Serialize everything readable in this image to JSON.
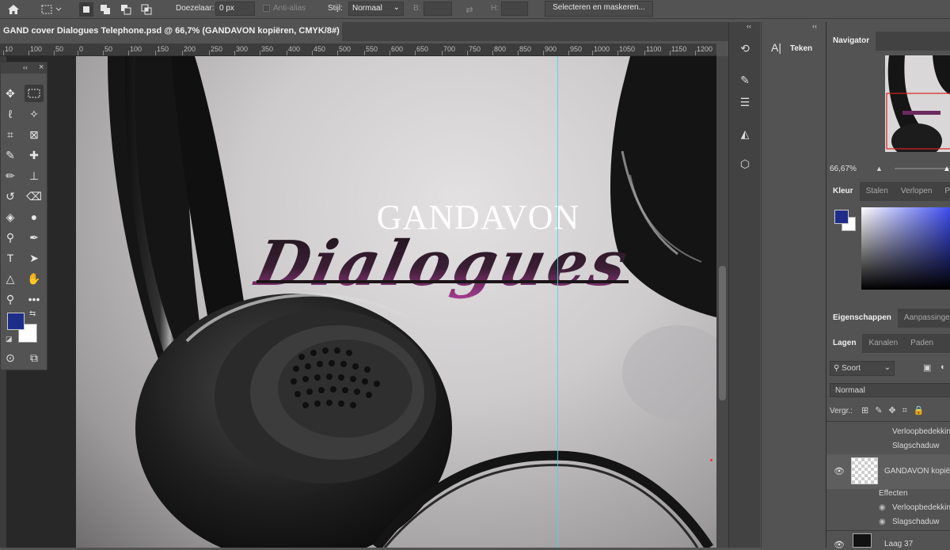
{
  "options_bar": {
    "home_icon": "home-icon",
    "marquee_icon": "rect-marquee-icon",
    "feather_label": "Doezelaar:",
    "feather_value": "0 px",
    "antialias_label": "Anti-alias",
    "style_label": "Stijl:",
    "style_value": "Normaal",
    "width_label": "B:",
    "height_label": "H:",
    "select_mask_label": "Selecteren en maskeren..."
  },
  "document": {
    "tab_title": "GAND cover Dialogues Telephone.psd @ 66,7% (GANDAVON kopiëren, CMYK/8#)",
    "close_glyph": "×"
  },
  "ruler": {
    "ticks": [
      "10",
      "100",
      "50",
      "0",
      "50",
      "100",
      "150",
      "200",
      "250",
      "300",
      "350",
      "400",
      "450",
      "500",
      "550",
      "600",
      "650",
      "700",
      "750",
      "800",
      "850",
      "900",
      "950",
      "1000",
      "1050",
      "1100",
      "1150",
      "1200"
    ]
  },
  "artwork": {
    "brand": "GANDAVON",
    "title": "Dialogues"
  },
  "colors": {
    "foreground": "#1f2d8a",
    "background": "#ffffff",
    "guide": "#36e0e0",
    "title_gradient_top": "#1c1418",
    "title_gradient_bottom": "#b23e9a"
  },
  "toolbox": {
    "collapse_glyph": "‹‹",
    "close_glyph": "×"
  },
  "teken_panel": {
    "label": "Teken",
    "collapse_glyph": "‹‹"
  },
  "navigator": {
    "tab": "Navigator",
    "zoom": "66,67%"
  },
  "color_panel": {
    "tabs": [
      "Kleur",
      "Stalen",
      "Verlopen",
      "P"
    ]
  },
  "properties_panel": {
    "tabs": [
      "Eigenschappen",
      "Aanpassingen"
    ]
  },
  "layers_panel": {
    "tabs": [
      "Lagen",
      "Kanalen",
      "Paden"
    ],
    "filter_kind": "Soort",
    "blend_mode": "Normaal",
    "lock_label": "Vergr.:",
    "rows": [
      {
        "name": "Verloopbedekking",
        "type": "effect"
      },
      {
        "name": "Slagschaduw",
        "type": "effect"
      },
      {
        "name": "GANDAVON kopiëren",
        "type": "layer"
      },
      {
        "name": "Effecten",
        "type": "effects-header"
      },
      {
        "name": "Verloopbedekking",
        "type": "effect"
      },
      {
        "name": "Slagschaduw",
        "type": "effect"
      },
      {
        "name": "Laag 37",
        "type": "layer"
      }
    ]
  }
}
